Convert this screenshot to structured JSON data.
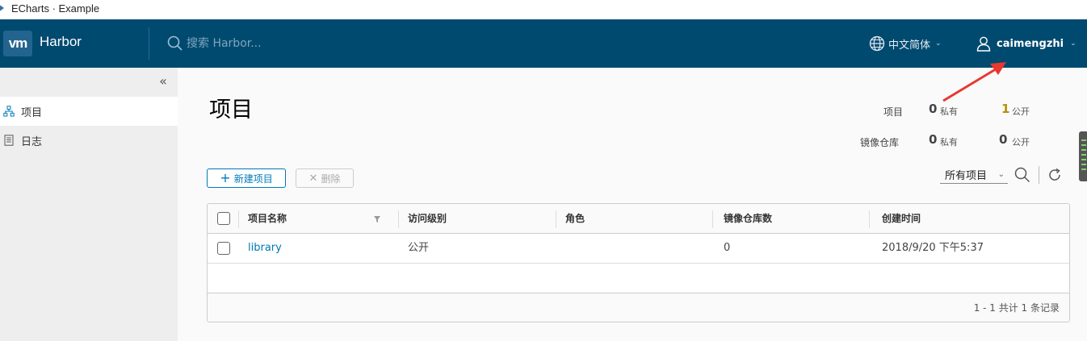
{
  "window": {
    "title": "ECharts · Example"
  },
  "header": {
    "logo_text": "vm",
    "brand": "Harbor",
    "search_placeholder": "搜索 Harbor...",
    "language": "中文简体",
    "username": "caimengzhi",
    "icons": [
      "search-icon",
      "globe-icon",
      "user-icon",
      "chevron-down-icon"
    ],
    "background_color": "#004a70"
  },
  "sidebar": {
    "collapse_icon": "double-chevron-left-icon",
    "items": [
      {
        "label": "项目",
        "icon": "org-chart-icon",
        "active": true
      },
      {
        "label": "日志",
        "icon": "document-icon",
        "active": false
      }
    ]
  },
  "main": {
    "title": "项目",
    "stats": {
      "projects_label": "项目",
      "repos_label": "镜像仓库",
      "projects_private": "0",
      "projects_public": "1",
      "repos_private": "0",
      "repos_public": "0",
      "private_label": "私有",
      "public_label": "公开"
    },
    "toolbar": {
      "new_button": "新建项目",
      "delete_button": "删除",
      "filter_selected": "所有项目",
      "icons": [
        "plus-icon",
        "close-icon",
        "search-icon",
        "refresh-icon"
      ]
    },
    "table": {
      "columns": [
        "项目名称",
        "访问级别",
        "角色",
        "镜像仓库数",
        "创建时间"
      ],
      "rows": [
        {
          "name": "library",
          "access": "公开",
          "role": "",
          "repo_count": "0",
          "created": "2018/9/20 下午5:37"
        }
      ],
      "footer": "1 - 1 共计 1 条记录"
    }
  },
  "colors": {
    "accent": "#0079b8",
    "annotation_arrow": "#e8382f"
  }
}
